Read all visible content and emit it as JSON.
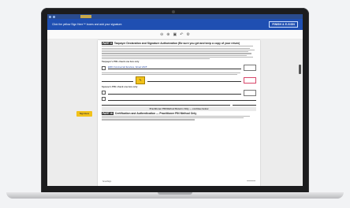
{
  "banner_text": "Click the yellow Sign Here™ boxes and add your signature.",
  "finish_label": "FINISH & E-SIGN",
  "toolbar_icons": [
    "zoom-out-icon",
    "zoom-in-icon",
    "page-icon",
    "back-icon",
    "settings-icon"
  ],
  "part_tag": "PART II",
  "part_heading": "Taxpayer Declaration and Signature Authorization (Be sure you get and keep a copy of your return)",
  "taxpayer_pin_heading": "Taxpayer's PIN: check one box only",
  "ero_line": "ERO Commercial Services, Smart 2018",
  "sign_here_label": "Sign Here",
  "spouse_pin_heading": "Spouse's PIN: check one box only",
  "practitioner_banner": "Practitioner PIN Method Returns Only — continue below",
  "part_iii_tag": "PART III",
  "part_iii_heading": "Certification and Authentication — Practitioner PIN Method Only",
  "footer_left": "SmartSign",
  "colors": {
    "brand": "#1f4fb2",
    "sign_here": "#f2c21b",
    "required_field": "#d8466a"
  }
}
